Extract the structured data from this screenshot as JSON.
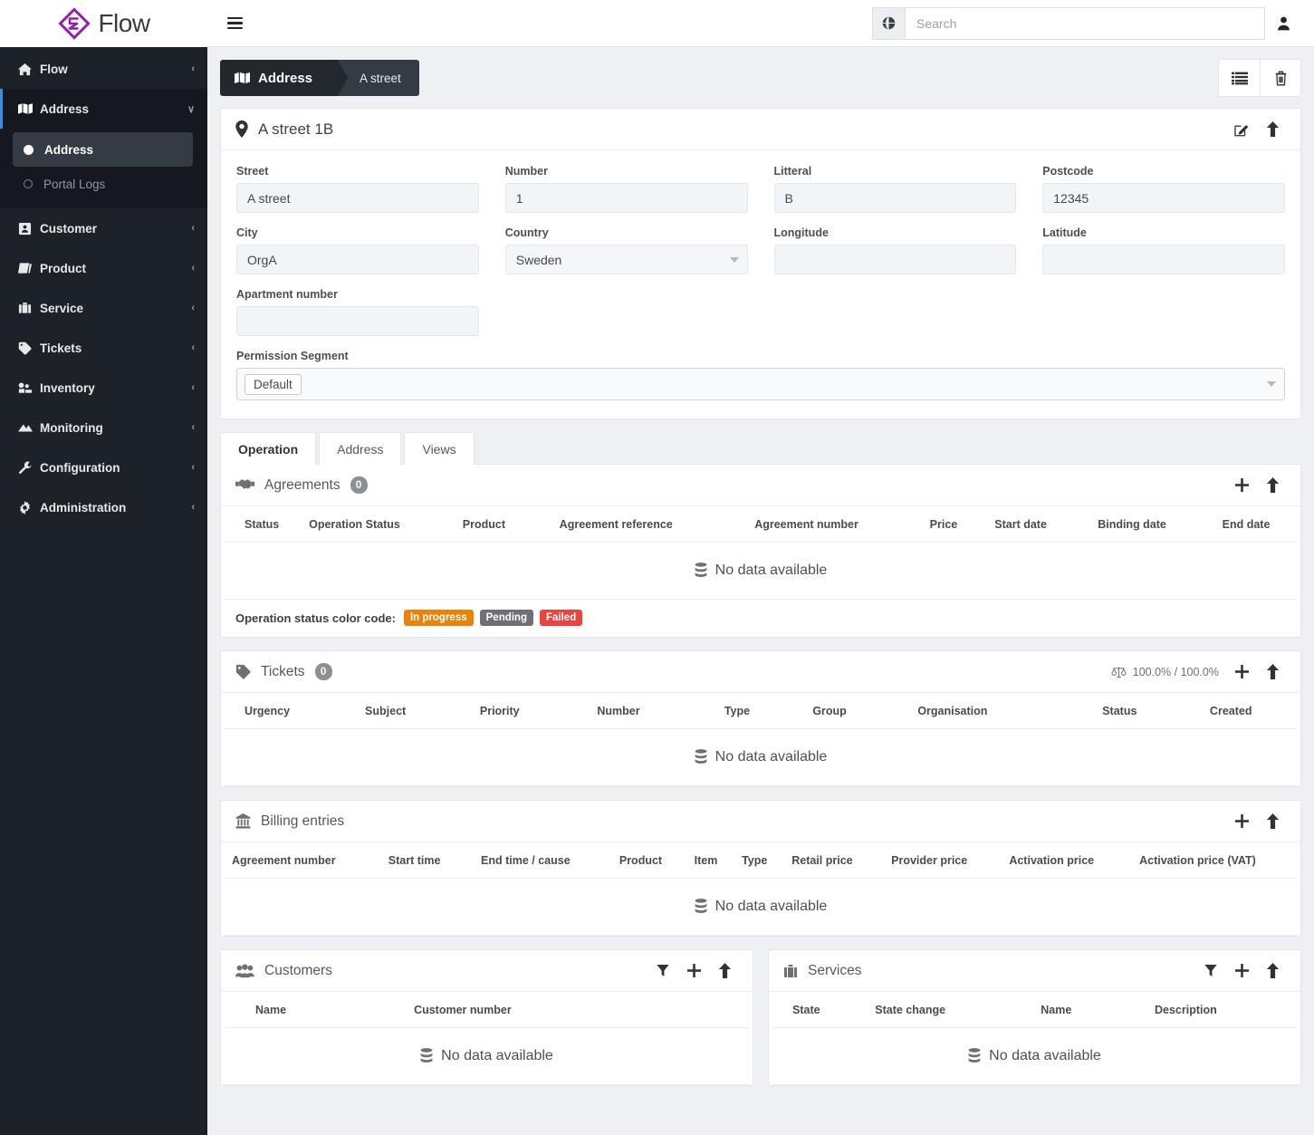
{
  "brand": {
    "name": "Flow",
    "logo_icon": "flow-diamond-logo",
    "accent": "#8e24aa"
  },
  "sidebar": {
    "items": [
      {
        "label": "Flow",
        "icon": "home-icon",
        "chevron": "‹",
        "state": "collapsed"
      },
      {
        "label": "Address",
        "icon": "map-icon",
        "chevron": "∨",
        "state": "expanded"
      },
      {
        "label": "Customer",
        "icon": "contact-card-icon",
        "chevron": "‹",
        "state": "collapsed"
      },
      {
        "label": "Product",
        "icon": "book-icon",
        "chevron": "‹",
        "state": "collapsed"
      },
      {
        "label": "Service",
        "icon": "briefcase-icon",
        "chevron": "‹",
        "state": "collapsed"
      },
      {
        "label": "Tickets",
        "icon": "tag-icon",
        "chevron": "‹",
        "state": "collapsed"
      },
      {
        "label": "Inventory",
        "icon": "boxes-icon",
        "chevron": "‹",
        "state": "collapsed"
      },
      {
        "label": "Monitoring",
        "icon": "area-chart-icon",
        "chevron": "‹",
        "state": "collapsed"
      },
      {
        "label": "Configuration",
        "icon": "wrench-icon",
        "chevron": "‹",
        "state": "collapsed"
      },
      {
        "label": "Administration",
        "icon": "gear-icon",
        "chevron": "‹",
        "state": "collapsed"
      }
    ],
    "subitems": [
      {
        "label": "Address",
        "active": true,
        "bullet": "filled-dot-icon"
      },
      {
        "label": "Portal Logs",
        "active": false,
        "bullet": "hollow-circle-icon"
      }
    ],
    "active_accent": "#3c8dde"
  },
  "topbar": {
    "menu_icon": "hamburger-icon",
    "search": {
      "placeholder": "Search",
      "value": "",
      "prefix_icon": "globe-icon"
    },
    "user_icon": "user-icon"
  },
  "breadcrumb": {
    "icon": "map-icon",
    "primary": "Address",
    "secondary": "A street",
    "actions": [
      {
        "icon": "list-icon",
        "name": "list-view-button"
      },
      {
        "icon": "trash-icon",
        "name": "delete-button"
      }
    ]
  },
  "address_card": {
    "icon": "map-pin-icon",
    "title": "A street 1B",
    "actions": [
      {
        "icon": "edit-icon",
        "name": "edit-button"
      },
      {
        "icon": "collapse-up-icon",
        "name": "collapse-button"
      }
    ],
    "fields": [
      {
        "label": "Street",
        "value": "A street",
        "type": "text"
      },
      {
        "label": "Number",
        "value": "1",
        "type": "text"
      },
      {
        "label": "Litteral",
        "value": "B",
        "type": "text"
      },
      {
        "label": "Postcode",
        "value": "12345",
        "type": "text"
      },
      {
        "label": "City",
        "value": "OrgA",
        "type": "text"
      },
      {
        "label": "Country",
        "value": "Sweden",
        "type": "select"
      },
      {
        "label": "Longitude",
        "value": "",
        "type": "text"
      },
      {
        "label": "Latitude",
        "value": "",
        "type": "text"
      },
      {
        "label": "Apartment number",
        "value": "",
        "type": "text"
      }
    ],
    "permission_segment": {
      "label": "Permission Segment",
      "tag": "Default"
    }
  },
  "tabs": [
    {
      "label": "Operation",
      "active": true
    },
    {
      "label": "Address",
      "active": false
    },
    {
      "label": "Views",
      "active": false
    }
  ],
  "panels": {
    "agreements": {
      "title": "Agreements",
      "icon": "handshake-icon",
      "count": "0",
      "actions": [
        {
          "icon": "plus-icon",
          "name": "add-agreement-button"
        },
        {
          "icon": "collapse-up-icon",
          "name": "collapse-button"
        }
      ],
      "columns": [
        "Status",
        "Operation Status",
        "Product",
        "Agreement reference",
        "Agreement number",
        "Price",
        "Start date",
        "Binding date",
        "End date"
      ],
      "empty_text": "No data available",
      "empty_icon": "database-icon",
      "color_code_label": "Operation status color code:",
      "color_code": [
        {
          "label": "In progress",
          "color": "#e8840c"
        },
        {
          "label": "Pending",
          "color": "#6d7175"
        },
        {
          "label": "Failed",
          "color": "#e8453c"
        }
      ]
    },
    "tickets": {
      "title": "Tickets",
      "icon": "tag-icon",
      "count": "0",
      "sla": {
        "icon": "balance-scale-icon",
        "text": "100.0% / 100.0%"
      },
      "actions": [
        {
          "icon": "plus-icon",
          "name": "add-ticket-button"
        },
        {
          "icon": "collapse-up-icon",
          "name": "collapse-button"
        }
      ],
      "columns": [
        "Urgency",
        "Subject",
        "Priority",
        "Number",
        "Type",
        "Group",
        "Organisation",
        "Status",
        "Created"
      ],
      "empty_text": "No data available",
      "empty_icon": "database-icon"
    },
    "billing": {
      "title": "Billing entries",
      "icon": "bank-icon",
      "actions": [
        {
          "icon": "plus-icon",
          "name": "add-billing-entry-button"
        },
        {
          "icon": "collapse-up-icon",
          "name": "collapse-button"
        }
      ],
      "columns": [
        "Agreement number",
        "Start time",
        "End time / cause",
        "Product",
        "Item",
        "Type",
        "Retail price",
        "Provider price",
        "Activation price",
        "Activation price (VAT)"
      ],
      "empty_text": "No data available",
      "empty_icon": "database-icon"
    },
    "customers": {
      "title": "Customers",
      "icon": "users-icon",
      "actions": [
        {
          "icon": "filter-icon",
          "name": "filter-button"
        },
        {
          "icon": "plus-icon",
          "name": "add-customer-button"
        },
        {
          "icon": "collapse-up-icon",
          "name": "collapse-button"
        }
      ],
      "columns": [
        "Name",
        "Customer number"
      ],
      "empty_text": "No data available",
      "empty_icon": "database-icon"
    },
    "services": {
      "title": "Services",
      "icon": "briefcase-icon",
      "actions": [
        {
          "icon": "filter-icon",
          "name": "filter-button"
        },
        {
          "icon": "plus-icon",
          "name": "add-service-button"
        },
        {
          "icon": "collapse-up-icon",
          "name": "collapse-button"
        }
      ],
      "columns": [
        "State",
        "State change",
        "Name",
        "Description"
      ],
      "empty_text": "No data available",
      "empty_icon": "database-icon"
    }
  }
}
